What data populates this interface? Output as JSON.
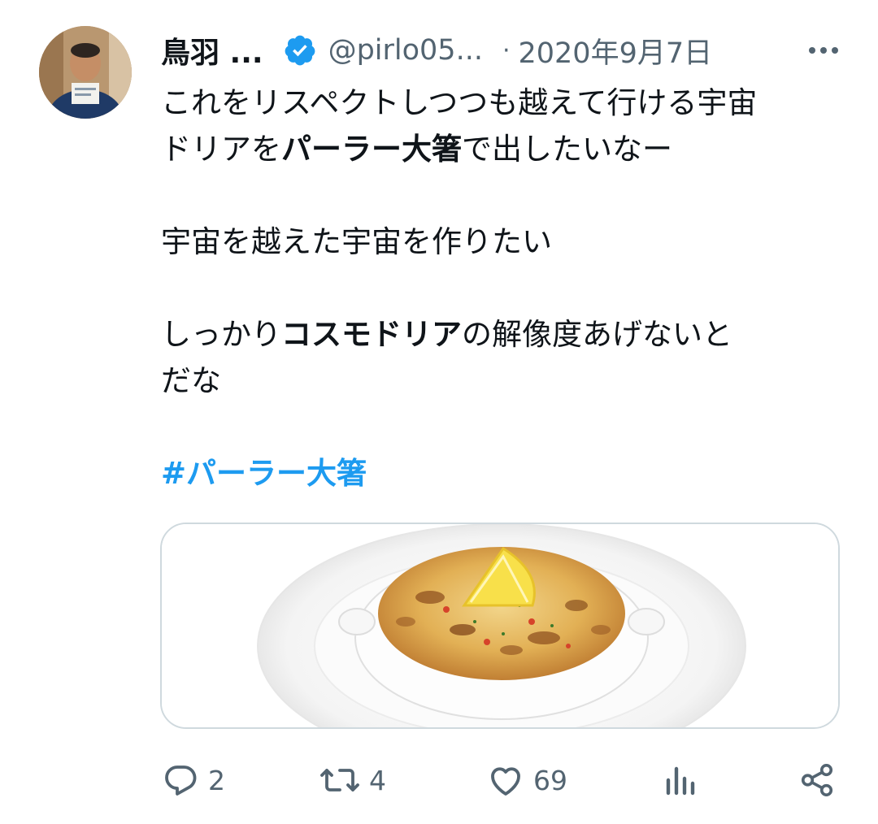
{
  "user": {
    "display_name": "鳥羽 ...",
    "handle": "@pirlo05...",
    "date": "2020年9月7日",
    "separator": "·"
  },
  "tweet": {
    "line1": "これをリスペクトしつつも越えて行ける宇宙",
    "line2_pre": "ドリアを",
    "line2_bold": "パーラー大箸",
    "line2_post": "で出したいなー",
    "line3": "宇宙を越えた宇宙を作りたい",
    "line4_pre": "しっかり",
    "line4_bold": "コスモドリア",
    "line4_post": "の解像度あげないと",
    "line5": "だな",
    "hashtag": "#パーラー大箸"
  },
  "actions": {
    "replies": "2",
    "retweets": "4",
    "likes": "69"
  },
  "colors": {
    "accent": "#1d9bf0",
    "text": "#0f1419",
    "muted": "#536471",
    "border": "#cfd9de"
  },
  "icons": [
    "avatar",
    "verified-badge-icon",
    "more-icon",
    "reply-icon",
    "retweet-icon",
    "like-icon",
    "analytics-icon",
    "share-icon"
  ]
}
